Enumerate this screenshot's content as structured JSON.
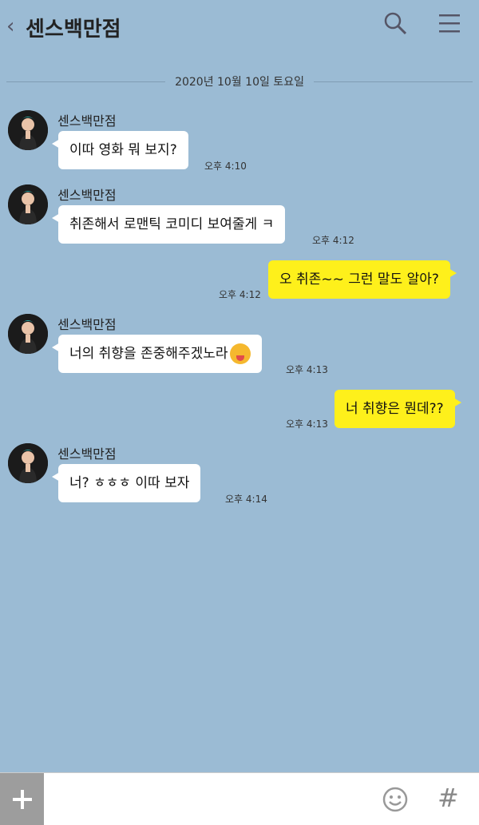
{
  "header": {
    "back_symbol": "‹",
    "title": "센스백만점",
    "icons": [
      "search-icon",
      "menu-icon"
    ]
  },
  "date_separator": "2020년 10월 10일 토요일",
  "messages": [
    {
      "direction": "in",
      "sender": "센스백만점",
      "text": "이따 영화 뭐 보지?",
      "time": "오후 4:10"
    },
    {
      "direction": "in",
      "sender": "센스백만점",
      "text": "취존해서 로맨틱 코미디 보여줄게 ㅋ",
      "time": "오후 4:12"
    },
    {
      "direction": "out",
      "text": "오 취존~~ 그런 말도 알아?",
      "time": "오후 4:12"
    },
    {
      "direction": "in",
      "sender": "센스백만점",
      "text": "너의 취향을 존중해주겠노라",
      "emoji": "tongue-out-wink-emoji",
      "time": "오후 4:13"
    },
    {
      "direction": "out",
      "text": "너 취향은 뭔데??",
      "time": "오후 4:13"
    },
    {
      "direction": "in",
      "sender": "센스백만점",
      "text": "너? ㅎㅎㅎ 이따 보자",
      "time": "오후 4:14"
    }
  ],
  "input_bar": {
    "placeholder": "",
    "hash_symbol": "#",
    "icons": [
      "plus-icon",
      "emoji-icon",
      "hash-icon"
    ]
  },
  "colors": {
    "background": "#9bbbd4",
    "incoming_bubble": "#ffffff",
    "outgoing_bubble": "#fef01b"
  }
}
